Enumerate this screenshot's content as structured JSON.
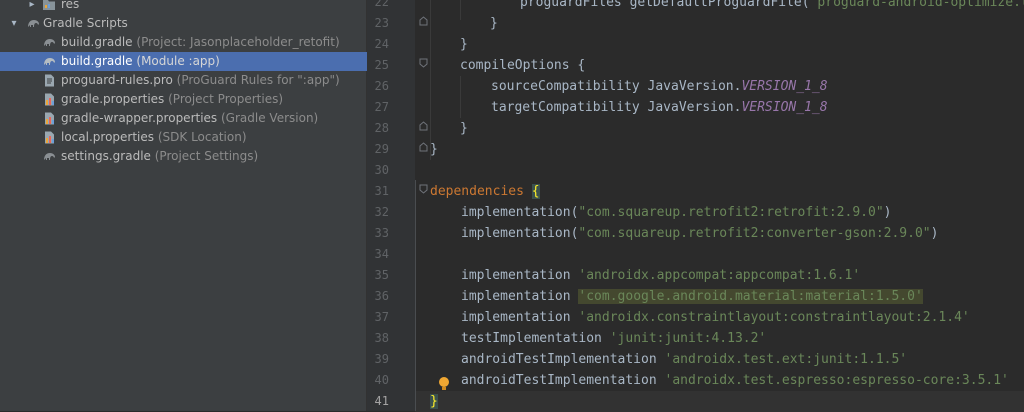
{
  "project_tree": {
    "items": [
      {
        "name": "res",
        "hint": ""
      },
      {
        "name": "Gradle Scripts",
        "hint": ""
      },
      {
        "name": "build.gradle",
        "hint": "(Project: Jasonplaceholder_retofit)"
      },
      {
        "name": "build.gradle",
        "hint": "(Module :app)"
      },
      {
        "name": "proguard-rules.pro",
        "hint": "(ProGuard Rules for \":app\")"
      },
      {
        "name": "gradle.properties",
        "hint": "(Project Properties)"
      },
      {
        "name": "gradle-wrapper.properties",
        "hint": "(Gradle Version)"
      },
      {
        "name": "local.properties",
        "hint": "(SDK Location)"
      },
      {
        "name": "settings.gradle",
        "hint": "(Project Settings)"
      }
    ],
    "selected_index": 3
  },
  "editor": {
    "line_numbers": [
      "22",
      "23",
      "24",
      "25",
      "26",
      "27",
      "28",
      "29",
      "30",
      "31",
      "32",
      "33",
      "34",
      "35",
      "36",
      "37",
      "38",
      "39",
      "40",
      "41"
    ],
    "current_line": "41",
    "lines": {
      "l22": {
        "a": "proguardFiles getDefaultProguardFile(",
        "b": "'proguard-android-optimize.txt'"
      },
      "l23": "}",
      "l24": "}",
      "l25": "compileOptions {",
      "l26": {
        "a": "sourceCompatibility JavaVersion.",
        "b": "VERSION_1_8"
      },
      "l27": {
        "a": "targetCompatibility JavaVersion.",
        "b": "VERSION_1_8"
      },
      "l28": "}",
      "l29": "}",
      "l31": {
        "a": "dependencies",
        "b": "{"
      },
      "l32": {
        "a": "implementation(",
        "b": "\"com.squareup.retrofit2:retrofit:2.9.0\"",
        "c": ")"
      },
      "l33": {
        "a": "implementation(",
        "b": "\"com.squareup.retrofit2:converter-gson:2.9.0\"",
        "c": ")"
      },
      "l35": {
        "a": "implementation ",
        "b": "'androidx.appcompat:appcompat:1.6.1'"
      },
      "l36": {
        "a": "implementation ",
        "b": "'com.google.android.material:material:1.5.0'"
      },
      "l37": {
        "a": "implementation ",
        "b": "'androidx.constraintlayout:constraintlayout:2.1.4'"
      },
      "l38": {
        "a": "testImplementation ",
        "b": "'junit:junit:4.13.2'"
      },
      "l39": {
        "a": "androidTestImplementation ",
        "b": "'androidx.test.ext:junit:1.1.5'"
      },
      "l40": {
        "a": "androidTestImplementation ",
        "b": "'androidx.test.espresso:espresso-core:3.5.1'"
      },
      "l41": "}"
    }
  },
  "colors": {
    "selection": "#4b6eaf",
    "keyword": "#cc7832",
    "string": "#6a8759",
    "constant": "#9876aa"
  }
}
